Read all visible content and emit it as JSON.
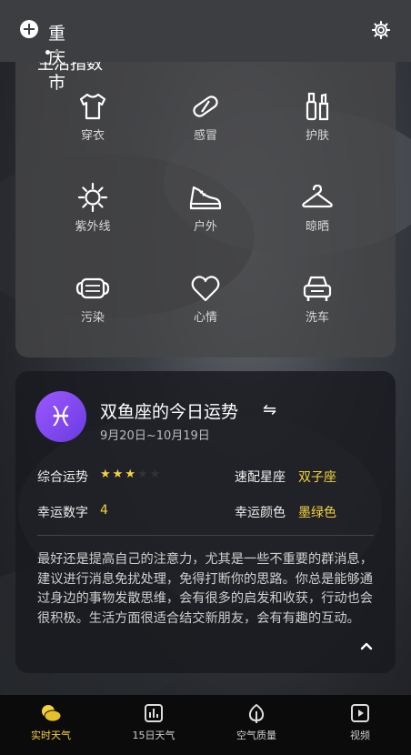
{
  "header": {
    "city": "重庆市",
    "add_icon": "plus-circle-icon",
    "settings_icon": "gear-icon",
    "page_dots": 2,
    "active_dot": 0
  },
  "life_index": {
    "title": "生活指数",
    "items": [
      {
        "label": "穿衣",
        "icon": "shirt-icon"
      },
      {
        "label": "感冒",
        "icon": "pill-icon"
      },
      {
        "label": "护肤",
        "icon": "skincare-icon"
      },
      {
        "label": "紫外线",
        "icon": "sun-icon"
      },
      {
        "label": "户外",
        "icon": "shoe-icon"
      },
      {
        "label": "晾晒",
        "icon": "hanger-icon"
      },
      {
        "label": "污染",
        "icon": "mask-icon"
      },
      {
        "label": "心情",
        "icon": "heart-icon"
      },
      {
        "label": "洗车",
        "icon": "car-icon"
      }
    ]
  },
  "horoscope": {
    "symbol": "♓",
    "title": "双鱼座的今日运势",
    "swap_icon": "⇋",
    "date_range": "9月20日~10月19日",
    "overall_label": "综合运势",
    "overall_rating": 3,
    "overall_max": 5,
    "match_label": "速配星座",
    "match_value": "双子座",
    "lucky_number_label": "幸运数字",
    "lucky_number_value": "4",
    "lucky_color_label": "幸运颜色",
    "lucky_color_value": "墨绿色",
    "description": "最好还是提高自己的注意力，尤其是一些不重要的群消息，建议进行消息免扰处理，免得打断你的思路。你总是能够通过身边的事物发散思维，会有很多的启发和收获，行动也会很积极。生活方面很适合结交新朋友，会有有趣的互动。",
    "accent_color": "#f5d33d"
  },
  "tabs": [
    {
      "label": "实时天气",
      "icon": "realtime-weather-icon",
      "active": true
    },
    {
      "label": "15日天气",
      "icon": "chart-icon",
      "active": false
    },
    {
      "label": "空气质量",
      "icon": "leaf-icon",
      "active": false
    },
    {
      "label": "视频",
      "icon": "video-icon",
      "active": false
    }
  ]
}
